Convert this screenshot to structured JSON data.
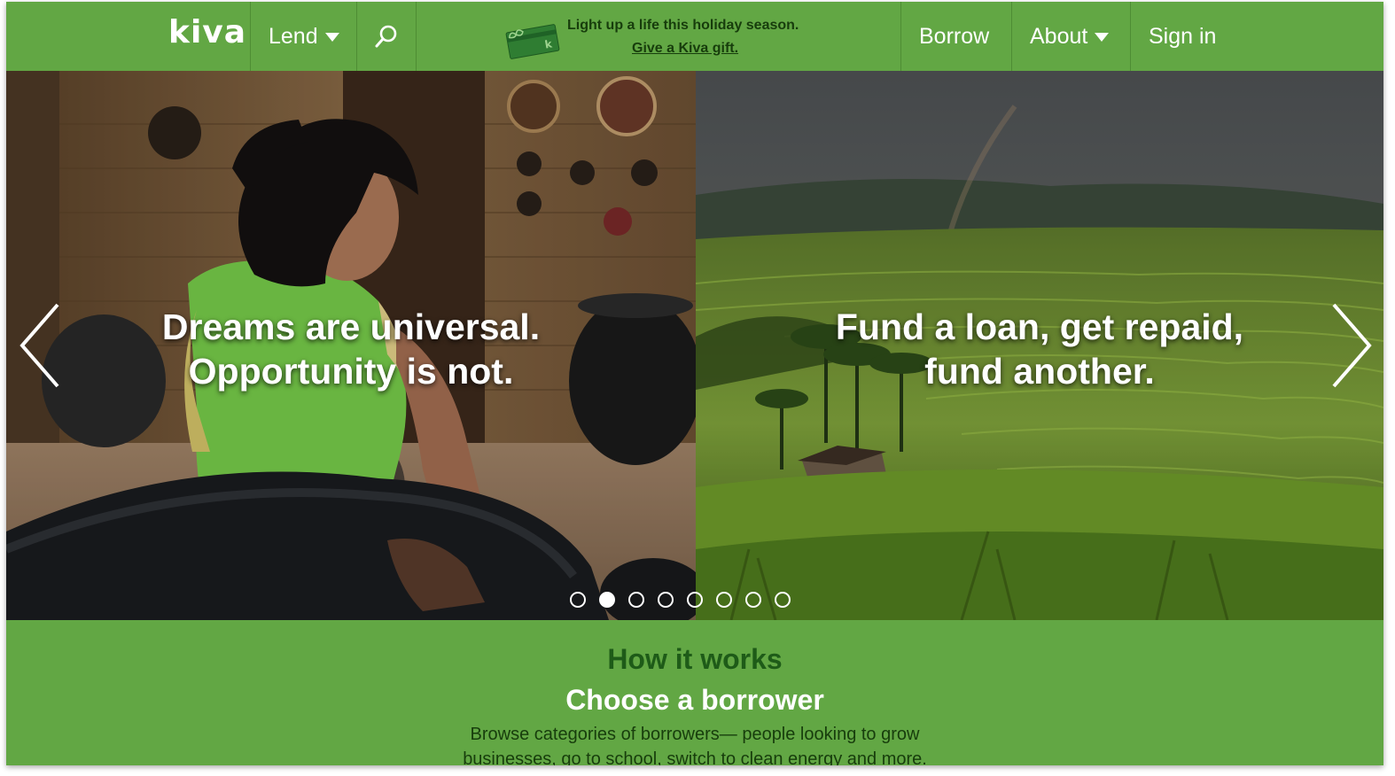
{
  "header": {
    "logo": "kiva",
    "nav": {
      "lend": "Lend",
      "borrow": "Borrow",
      "about": "About",
      "sign_in": "Sign in"
    },
    "promo": {
      "line": "Light up a life this holiday season.",
      "link": "Give a Kiva gift."
    }
  },
  "hero": {
    "slides": [
      {
        "title_line1": "Dreams are universal.",
        "title_line2": "Opportunity is not."
      },
      {
        "title_line1": "Fund a loan, get repaid,",
        "title_line2": "fund another."
      }
    ],
    "dots_count": 8,
    "active_dot": 2
  },
  "how_it_works": {
    "title": "How it works",
    "subtitle": "Choose a borrower",
    "description": "Browse categories of borrowers— people looking to grow businesses, go to school, switch to clean energy and more."
  },
  "colors": {
    "brand_green": "#62a744",
    "dark_green": "#1e5b18"
  },
  "icons": [
    "search-icon",
    "gift-card-icon",
    "chevron-left-icon",
    "chevron-right-icon",
    "caret-down-icon"
  ]
}
